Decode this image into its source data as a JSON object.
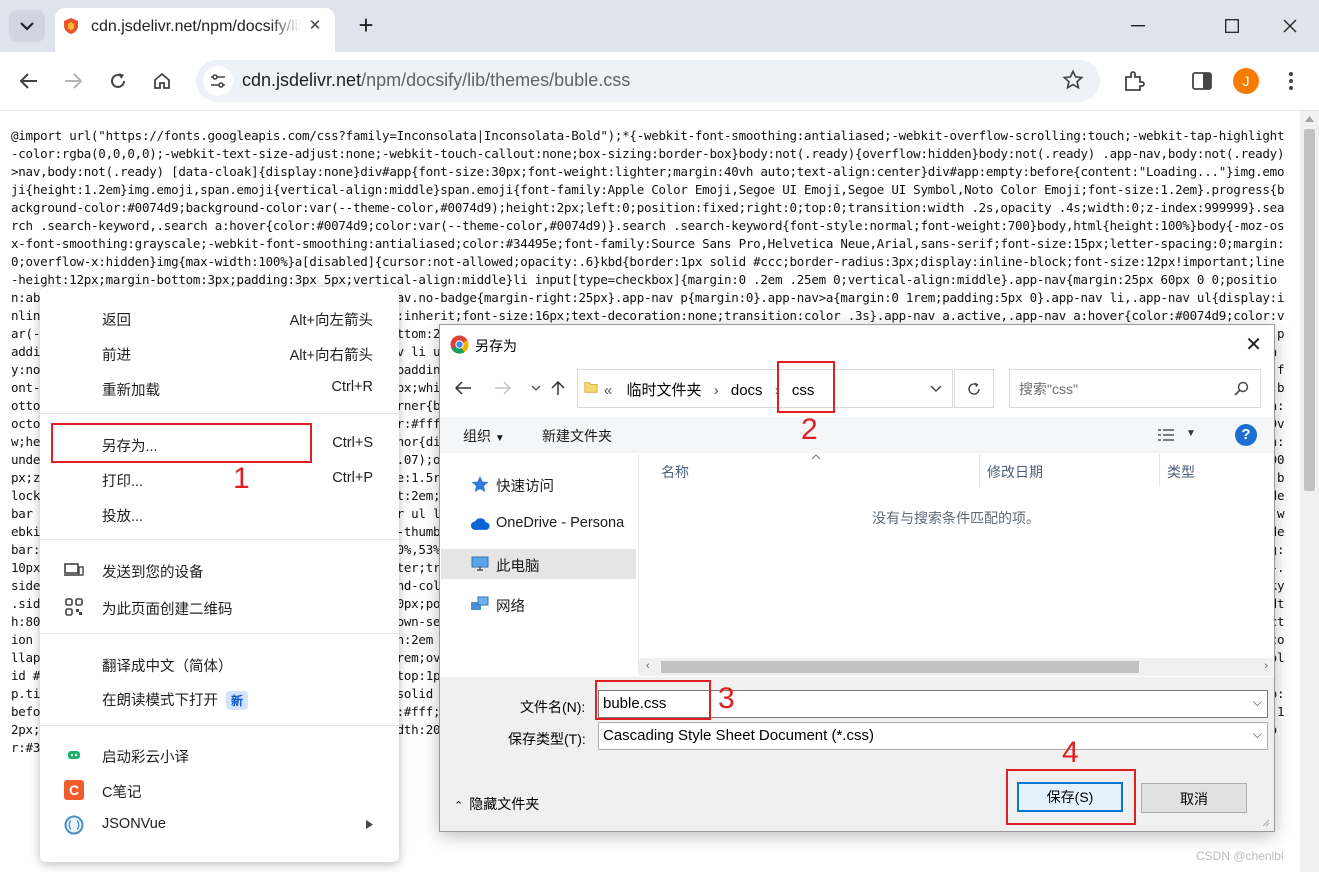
{
  "browser": {
    "tab_title": "cdn.jsdelivr.net/npm/docsify/lib/themes/buble.css",
    "url_host": "cdn.jsdelivr.net",
    "url_path": "/npm/docsify/lib/themes/buble.css",
    "avatar_letter": "J",
    "accent_color": "#f57c00"
  },
  "page": {
    "code": "@import url(\"https://fonts.googleapis.com/css?family=Inconsolata|Inconsolata-Bold\");*{-webkit-font-smoothing:antialiased;-webkit-overflow-scrolling:touch;-webkit-tap-highlight-color:rgba(0,0,0,0);-webkit-text-size-adjust:none;-webkit-touch-callout:none;box-sizing:border-box}body:not(.ready){overflow:hidden}body:not(.ready) .app-nav,body:not(.ready)>nav,body:not(.ready) [data-cloak]{display:none}div#app{font-size:30px;font-weight:lighter;margin:40vh auto;text-align:center}div#app:empty:before{content:\"Loading...\"}img.emoji{height:1.2em}img.emoji,span.emoji{vertical-align:middle}span.emoji{font-family:Apple Color Emoji,Segoe UI Emoji,Segoe UI Symbol,Noto Color Emoji;font-size:1.2em}.progress{background-color:#0074d9;background-color:var(--theme-color,#0074d9);height:2px;left:0;position:fixed;right:0;top:0;transition:width .2s,opacity .4s;width:0;z-index:999999}.search .search-keyword,.search a:hover{color:#0074d9;color:var(--theme-color,#0074d9)}.search .search-keyword{font-style:normal;font-weight:700}body,html{height:100%}body{-moz-osx-font-smoothing:grayscale;-webkit-font-smoothing:antialiased;color:#34495e;font-family:Source Sans Pro,Helvetica Neue,Arial,sans-serif;font-size:15px;letter-spacing:0;margin:0;overflow-x:hidden}img{max-width:100%}a[disabled]{cursor:not-allowed;opacity:.6}kbd{border:1px solid #ccc;border-radius:3px;display:inline-block;font-size:12px!important;line-height:12px;margin-bottom:3px;padding:3px 5px;vertical-align:middle}li input[type=checkbox]{margin:0 .2em .25em 0;vertical-align:middle}.app-nav{margin:25px 60px 0 0;position:absolute;right:0;text-align:right;z-index:10}.app-nav.no-badge{margin-right:25px}.app-nav p{margin:0}.app-nav>a{margin:0 1rem;padding:5px 0}.app-nav li,.app-nav ul{display:inline-block;list-style:none;margin:0}.app-nav a{color:inherit;font-size:16px;text-decoration:none;transition:color .3s}.app-nav a.active,.app-nav a:hover{color:#0074d9;color:var(--theme-color,#0074d9)}.app-nav a.active{border-bottom:2px solid #0074d9;border-bottom:2px solid var(--theme-color,#0074d9)}.app-nav li{display:inline-block;margin:0 1rem;padding:5px 0;position:relative;cursor:pointer}.app-nav li ul{background-color:#fff;border:1px solid;border-color:#ddd #ddd #ccc;border-radius:4px;box-sizing:border-box;display:none;max-height:calc(100vh - 61px);overflow-y:auto;padding:10px 0;position:absolute;right:-15px;text-align:left;top:100%;white-space:nowrap}.app-nav li ul li{display:block;font-size:14px;line-height:1rem;margin:0;margin:8px 14px;white-space:nowrap}.app-nav li ul a{display:block;font-size:inherit;margin:0;padding:0}.app-nav li ul a.active{border-bottom:0}.app-nav li:hover ul{display:block}.github-corner{border-bottom:0;position:fixed;right:0;text-decoration:none;top:0;z-index:1}.github-corner:hover .octo-arm{animation:octocat-wave .56s ease-in-out}.github-corner svg{color:#fff;fill:#0074d9;fill:var(--theme-color,#0074d9);height:80px;width:80px}main{display:block;position:relative;width:100vw;height:100%;z-index:0}main.hidden{display:none}.anchor{display:inline-block;text-decoration:none;transition:all .3s}.anchor span{color:#34495e}.anchor:hover{text-decoration:underline}.sidebar{border-right:1px solid rgba(0,0,0,.07);overflow-y:auto;padding:40px 0 0;position:absolute;top:0;bottom:0;left:0;transition:transform .25s ease-out;width:300px;z-index:20}.sidebar>h1{margin:0 auto 1rem;font-size:1.5rem;font-weight:300;text-align:center}.sidebar>h1 a{color:inherit;text-decoration:none}.sidebar>h1 .app-nav{display:block;position:static}.sidebar .sidebar-nav{line-height:2em;padding-bottom:40px}.sidebar li.collapse .app-sub-sidebar{display:none}.sidebar ul{margin:0 0 0 15px;padding:0}.sidebar li>p{font-weight:700;margin:0}.sidebar ul,.sidebar ul li{list-style:none}.sidebar ul li a{border-bottom:none;display:block}.sidebar ul li ul{padding-left:20px}.sidebar::-webkit-scrollbar{width:4px}.sidebar::-webkit-scrollbar-thumb{background:transparent;border-radius:4px}.sidebar:hover::-webkit-scrollbar-thumb{background:hsla(0,0%,53%,.4)}.sidebar:hover::-webkit-scrollbar-track{background:hsla(0,0%,53%,.1)}.sidebar-toggle{background-color:transparent;background-color:hsla(0,0%,100%,.8);border:0;outline:none;padding:10px;position:absolute;bottom:0;left:0;text-align:center;transition:opacity .3s;width:284px;z-index:30;cursor:pointer}.sidebar-toggle:hover .sidebar-toggle-button{opacity:.4}.sidebar-toggle span{background-color:#0074d9;background-color:var(--theme-color,#0074d9);display:block;margin-bottom:4px;width:16px;height:2px}body.sticky .sidebar,body.sticky .sidebar-toggle{position:fixed}.content{padding-top:60px;position:absolute;top:0;right:0;bottom:0;left:300px;transition:left .25s ease}.markdown-section{margin:0 auto;max-width:80%;padding:30px 15px 40px;position:relative}.markdown-section>*{box-sizing:border-box;font-size:inherit}.markdown-section>:first-child{margin-top:0!important}.markdown-section hr{border:none;border-bottom:1px solid #eee;margin:2em 0}.markdown-section iframe{border:1px solid #eee;width:1px;min-width:100%}.markdown-section table{border-collapse:collapse;border-spacing:0;display:block;margin-bottom:1rem;overflow:auto;width:100%}.markdown-section th{font-weight:700}.markdown-section td,.markdown-section th{border:1px solid #ddd;padding:6px 13px}.markdown-section tr{border-top:1px solid #ccc}.markdown-section p.tip,.markdown-section tr:nth-child(2n){background-color:#f8f8f8}.markdown-section p.tip{border-bottom-right-radius:2px;border-left:4px solid #f66;border-top-right-radius:2px;margin:2em 0;padding:12px 24px 12px 30px;position:relative}.markdown-section p.tip:before{background-color:#f66;border-radius:100%;color:#fff;content:\"!\";font-family:Dosis,Source Sans Pro,Helvetica Neue,Arial,sans-serif;font-size:14px;font-weight:700;left:-12px;line-height:20px;position:absolute;height:20px;width:20px;text-align:center;top:14px}.markdown-section p.tip code{background-color:#efefef}.markdown-section p.tip em{color:#34495e}"
  },
  "context_menu": {
    "items": [
      {
        "label": "返回",
        "shortcut": "Alt+向左箭头"
      },
      {
        "label": "前进",
        "shortcut": "Alt+向右箭头"
      },
      {
        "label": "重新加载",
        "shortcut": "Ctrl+R"
      },
      {
        "label": "另存为...",
        "shortcut": "Ctrl+S"
      },
      {
        "label": "打印...",
        "shortcut": "Ctrl+P"
      },
      {
        "label": "投放...",
        "shortcut": ""
      },
      {
        "label": "发送到您的设备",
        "shortcut": "",
        "icon": "devices-icon"
      },
      {
        "label": "为此页面创建二维码",
        "shortcut": "",
        "icon": "qr-code-icon"
      },
      {
        "label": "翻译成中文（简体）",
        "shortcut": ""
      },
      {
        "label": "在朗读模式下打开",
        "shortcut": "",
        "badge": "新"
      },
      {
        "label": "启动彩云小译",
        "shortcut": "",
        "icon": "caiyun-translate-icon"
      },
      {
        "label": "C笔记",
        "shortcut": "",
        "icon": "c-note-icon"
      },
      {
        "label": "JSONVue",
        "shortcut": "",
        "icon": "jsonvue-icon"
      }
    ]
  },
  "dialog": {
    "title": "另存为",
    "breadcrumb": {
      "prefix": "«",
      "parts": [
        "临时文件夹",
        "docs",
        "css"
      ]
    },
    "search_placeholder": "搜索\"css\"",
    "toolbar": {
      "organize": "组织",
      "new_folder": "新建文件夹"
    },
    "nav": [
      "快速访问",
      "OneDrive - Persona",
      "此电脑",
      "网络"
    ],
    "columns": [
      "名称",
      "修改日期",
      "类型"
    ],
    "empty_message": "没有与搜索条件匹配的项。",
    "filename_label": "文件名(N):",
    "filename_value": "buble.css",
    "filetype_label": "保存类型(T):",
    "filetype_value": "Cascading Style Sheet Document (*.css)",
    "hide_folders": "隐藏文件夹",
    "save_button": "保存(S)",
    "cancel_button": "取消"
  },
  "annotations": {
    "labels": [
      "1",
      "2",
      "3",
      "4"
    ],
    "color": "#e02020"
  },
  "watermark": "CSDN @chenlbl"
}
